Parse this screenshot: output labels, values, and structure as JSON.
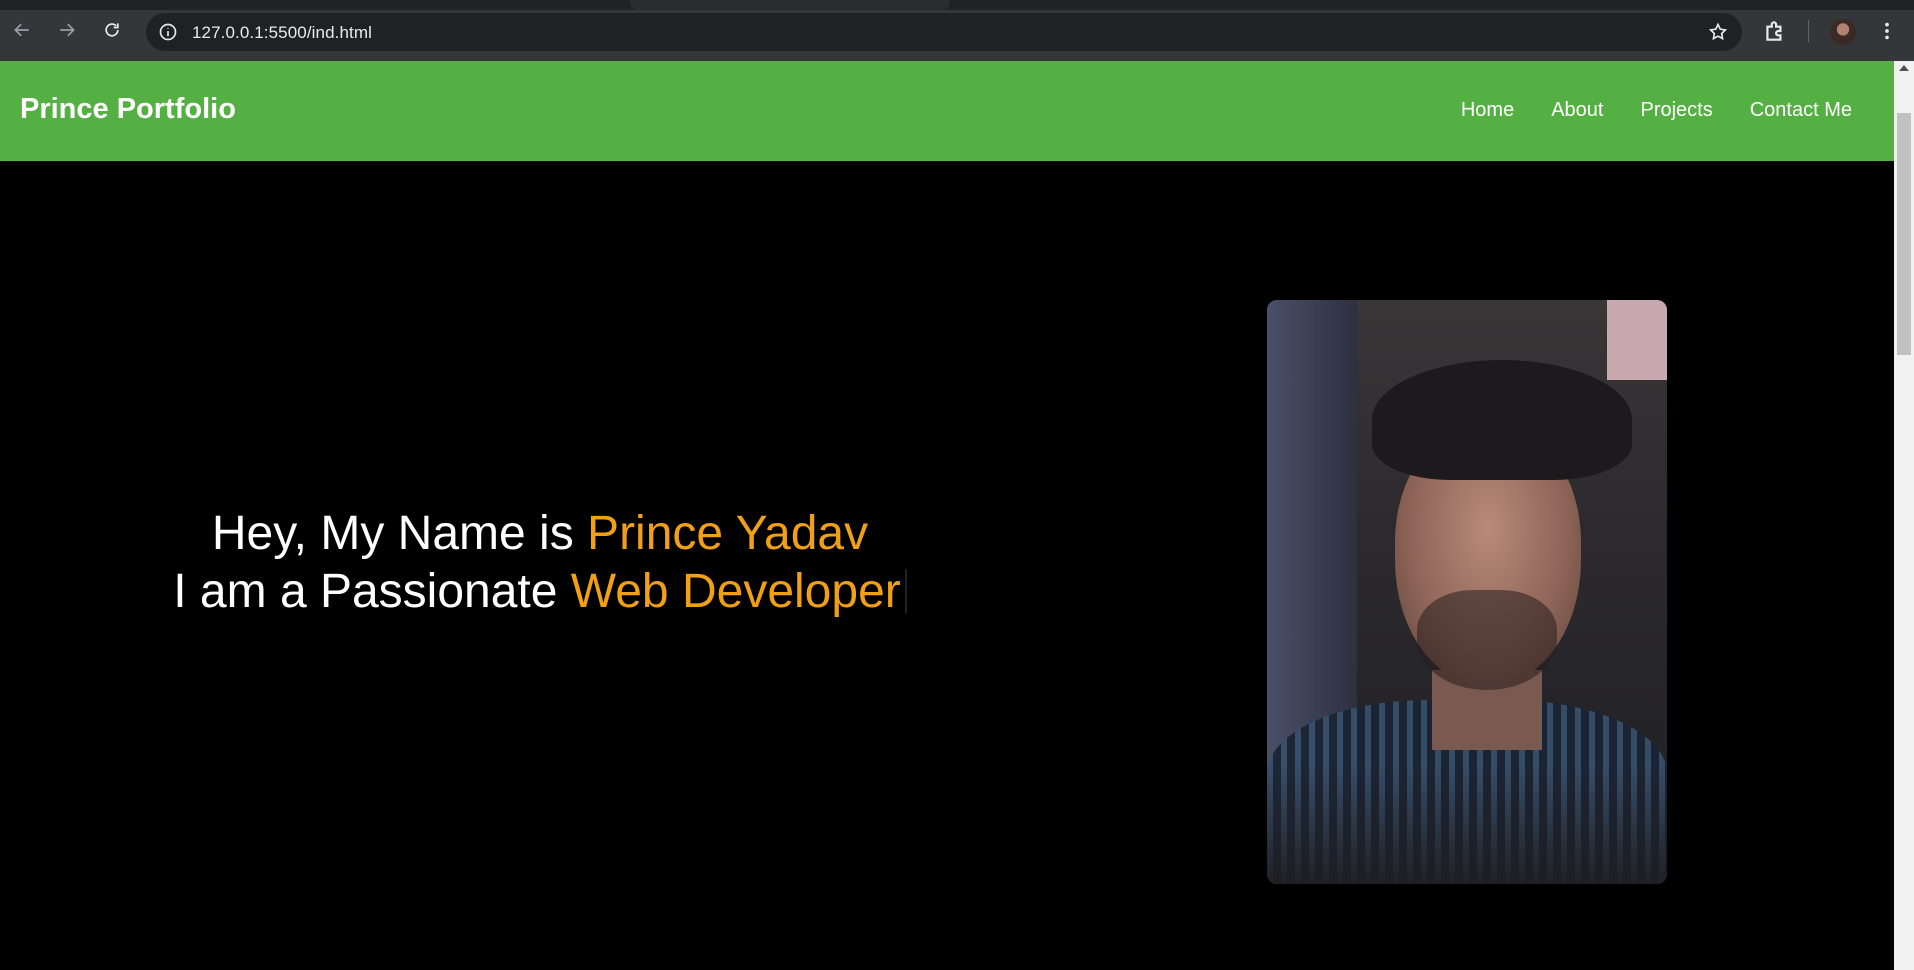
{
  "browser": {
    "url": "127.0.0.1:5500/ind.html"
  },
  "site": {
    "brand": "Prince Portfolio",
    "nav": [
      "Home",
      "About",
      "Projects",
      "Contact Me"
    ]
  },
  "hero": {
    "line1_prefix": "Hey, My Name is ",
    "line1_highlight": "Prince Yadav",
    "line2_prefix": "I am a Passionate ",
    "line2_highlight": "Web Developer"
  },
  "colors": {
    "header_bg": "#55b043",
    "accent": "#f0a012",
    "page_bg": "#000000"
  }
}
